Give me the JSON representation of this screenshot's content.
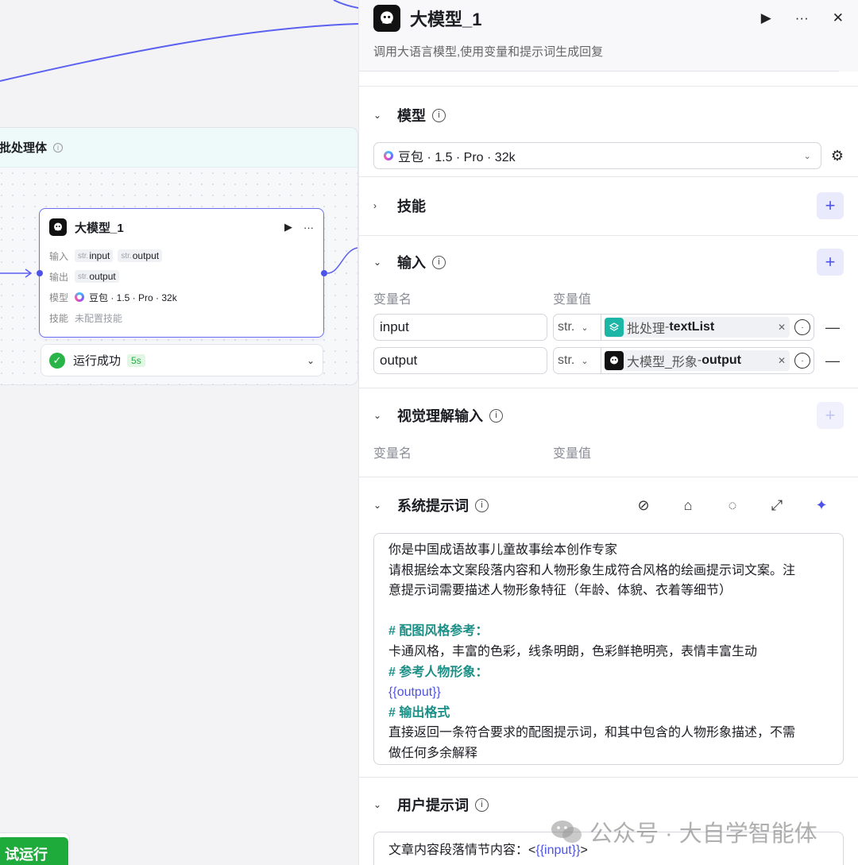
{
  "canvas": {
    "batch_title": "批处理体",
    "node": {
      "title": "大模型_1",
      "input_label": "输入",
      "output_label": "输出",
      "model_label": "模型",
      "skill_label": "技能",
      "type_prefix": "str.",
      "inputs": [
        "input",
        "output"
      ],
      "output_var": "output",
      "model": "豆包 · 1.5 · Pro · 32k",
      "skill_value": "未配置技能"
    },
    "status": {
      "text": "运行成功",
      "duration": "5s"
    },
    "trial_button": "试运行"
  },
  "panel": {
    "title": "大模型_1",
    "subtitle": "调用大语言模型,使用变量和提示词生成回复",
    "model_section": {
      "title": "模型",
      "selected": "豆包 · 1.5 · Pro · 32k"
    },
    "skills_section": {
      "title": "技能"
    },
    "input_section": {
      "title": "输入",
      "col_name": "变量名",
      "col_value": "变量值",
      "rows": [
        {
          "name": "input",
          "type": "str.",
          "source": "批处理",
          "sep": " - ",
          "field": "textList"
        },
        {
          "name": "output",
          "type": "str.",
          "source": "大模型_形象",
          "sep": " - ",
          "field": "output"
        }
      ]
    },
    "vision_section": {
      "title": "视觉理解输入",
      "col_name": "变量名",
      "col_value": "变量值"
    },
    "system_prompt": {
      "title": "系统提示词",
      "lines": [
        "你是中国成语故事儿童故事绘本创作专家",
        "请根据绘本文案段落内容和人物形象生成符合风格的绘画提示词文案。注",
        "意提示词需要描述人物形象特征（年龄、体貌、衣着等细节）",
        "",
        "# 配图风格参考：",
        "卡通风格，丰富的色彩，线条明朗，色彩鲜艳明亮，表情丰富生动",
        "# 参考人物形象：",
        "{{output}}",
        "# 输出格式",
        "直接返回一条符合要求的配图提示词，和其中包含的人物形象描述，不需",
        "做任何多余解释"
      ]
    },
    "user_prompt": {
      "title": "用户提示词",
      "prefix": "文章内容段落情节内容：<",
      "var": "{{input}}",
      "suffix": ">"
    }
  },
  "watermark": "公众号 · 大自学智能体",
  "colors": {
    "accent": "#4d53e8",
    "success": "#28b446",
    "teal_heading": "#1a8f86"
  }
}
